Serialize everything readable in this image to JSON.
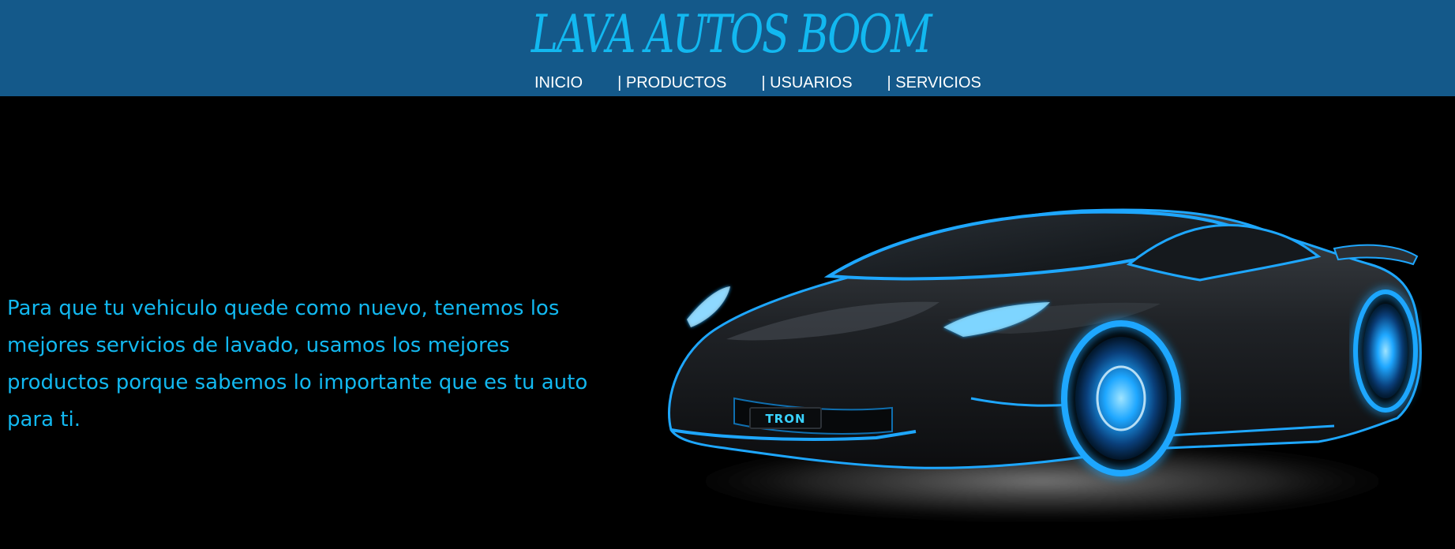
{
  "header": {
    "title": "LAVA AUTOS BOOM",
    "nav": [
      {
        "label": "INICIO"
      },
      {
        "label": "| PRODUCTOS"
      },
      {
        "label": "| USUARIOS"
      },
      {
        "label": "| SERVICIOS"
      }
    ]
  },
  "main": {
    "intro_text": "Para que tu vehiculo quede como nuevo, tenemos los mejores servicios de lavado, usamos los mejores productos porque sabemos lo importante que es tu auto para ti.",
    "hero_image": {
      "plate_text": "TRON"
    }
  },
  "colors": {
    "header_bg": "#14598a",
    "page_bg": "#000000",
    "accent": "#12b8f0",
    "nav_text": "#ffffff",
    "car_glow": "#1ea7ff"
  }
}
